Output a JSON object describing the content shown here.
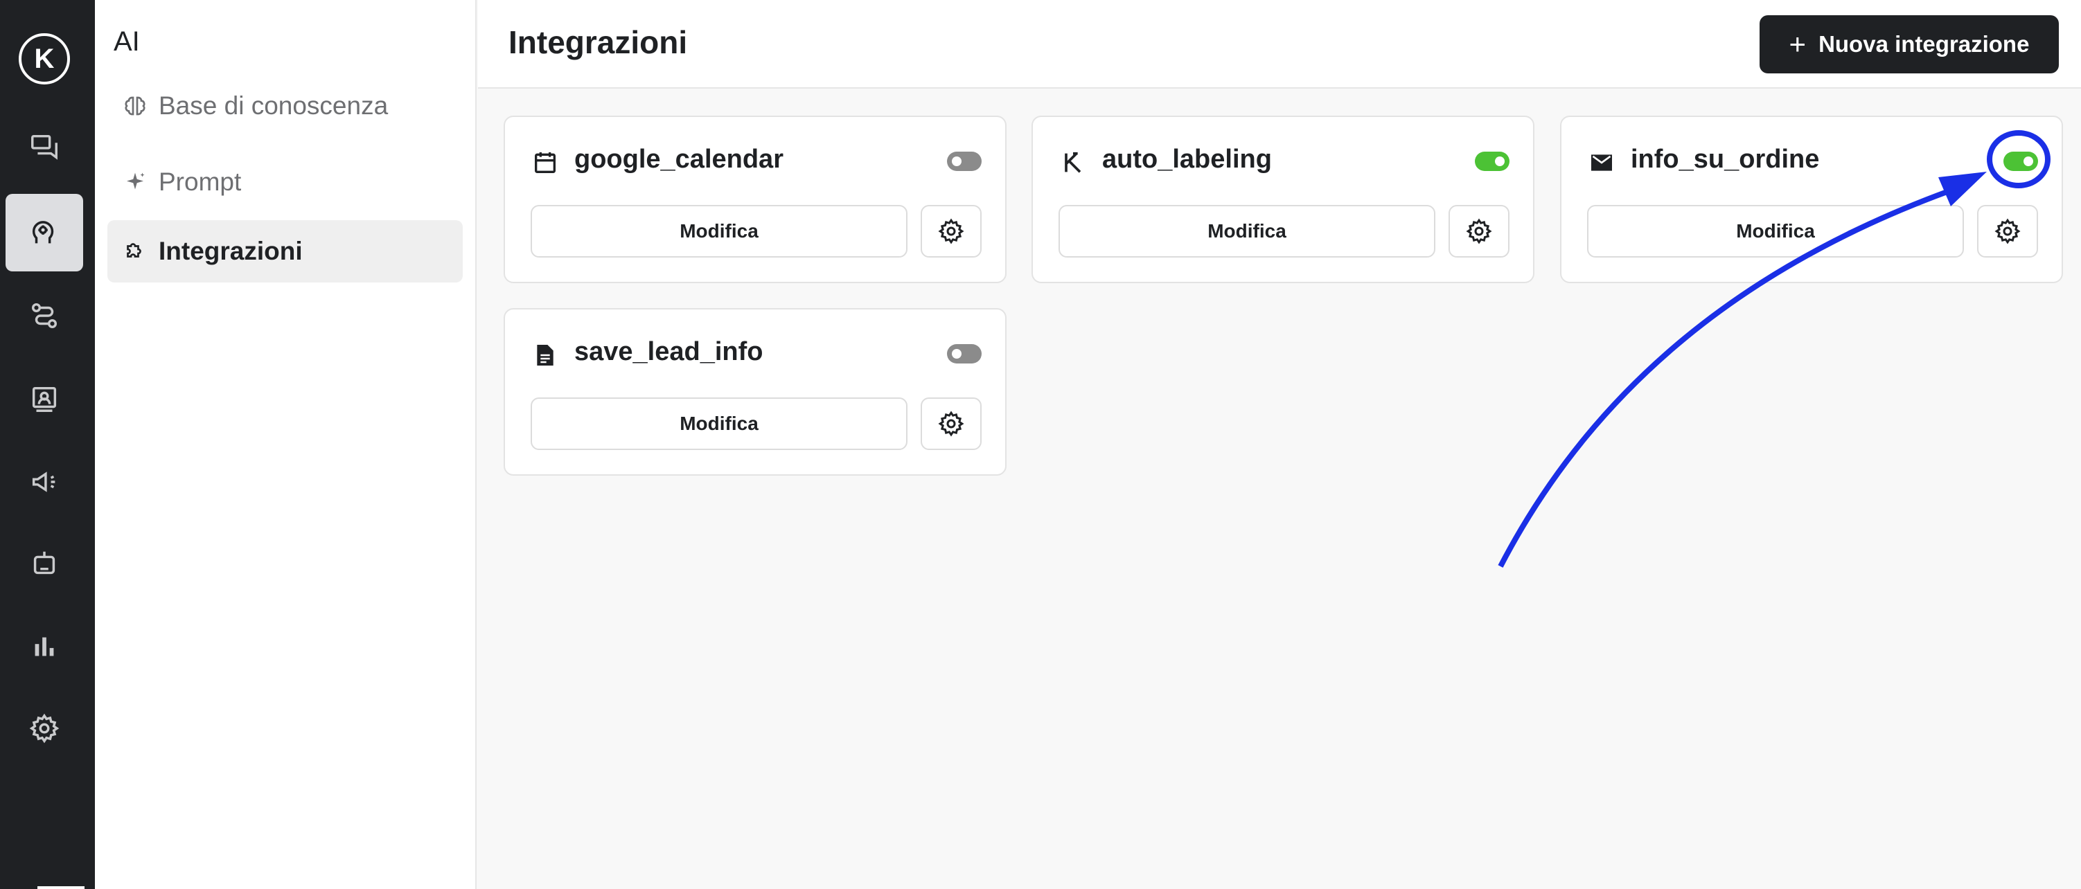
{
  "rail": {
    "logo_glyph": "K",
    "items": [
      {
        "name": "conversations-icon",
        "active": false
      },
      {
        "name": "ai-head-icon",
        "active": true
      },
      {
        "name": "routes-icon",
        "active": false
      },
      {
        "name": "contacts-icon",
        "active": false
      },
      {
        "name": "megaphone-icon",
        "active": false
      },
      {
        "name": "bot-icon",
        "active": false
      },
      {
        "name": "bar-chart-icon",
        "active": false
      },
      {
        "name": "gear-icon",
        "active": false
      }
    ]
  },
  "subnav": {
    "title": "AI",
    "items": [
      {
        "label": "Base di conoscenza",
        "icon": "brain-icon",
        "active": false
      },
      {
        "label": "Prompt",
        "icon": "sparkle-icon",
        "active": false
      },
      {
        "label": "Integrazioni",
        "icon": "puzzle-icon",
        "active": true
      }
    ]
  },
  "header": {
    "title": "Integrazioni",
    "new_button_label": "Nuova integrazione",
    "new_button_icon": "plus-icon"
  },
  "integrations": [
    {
      "name": "google_calendar",
      "icon": "calendar-icon",
      "enabled": false,
      "edit_label": "Modifica"
    },
    {
      "name": "auto_labeling",
      "icon": "brand-logo-icon",
      "enabled": true,
      "edit_label": "Modifica"
    },
    {
      "name": "info_su_ordine",
      "icon": "mail-icon",
      "enabled": true,
      "edit_label": "Modifica"
    },
    {
      "name": "save_lead_info",
      "icon": "document-icon",
      "enabled": false,
      "edit_label": "Modifica"
    }
  ],
  "colors": {
    "rail_bg": "#1f2124",
    "toggle_on": "#4cc235",
    "toggle_off": "#8b8b8b",
    "annotation": "#1a2fe6"
  }
}
